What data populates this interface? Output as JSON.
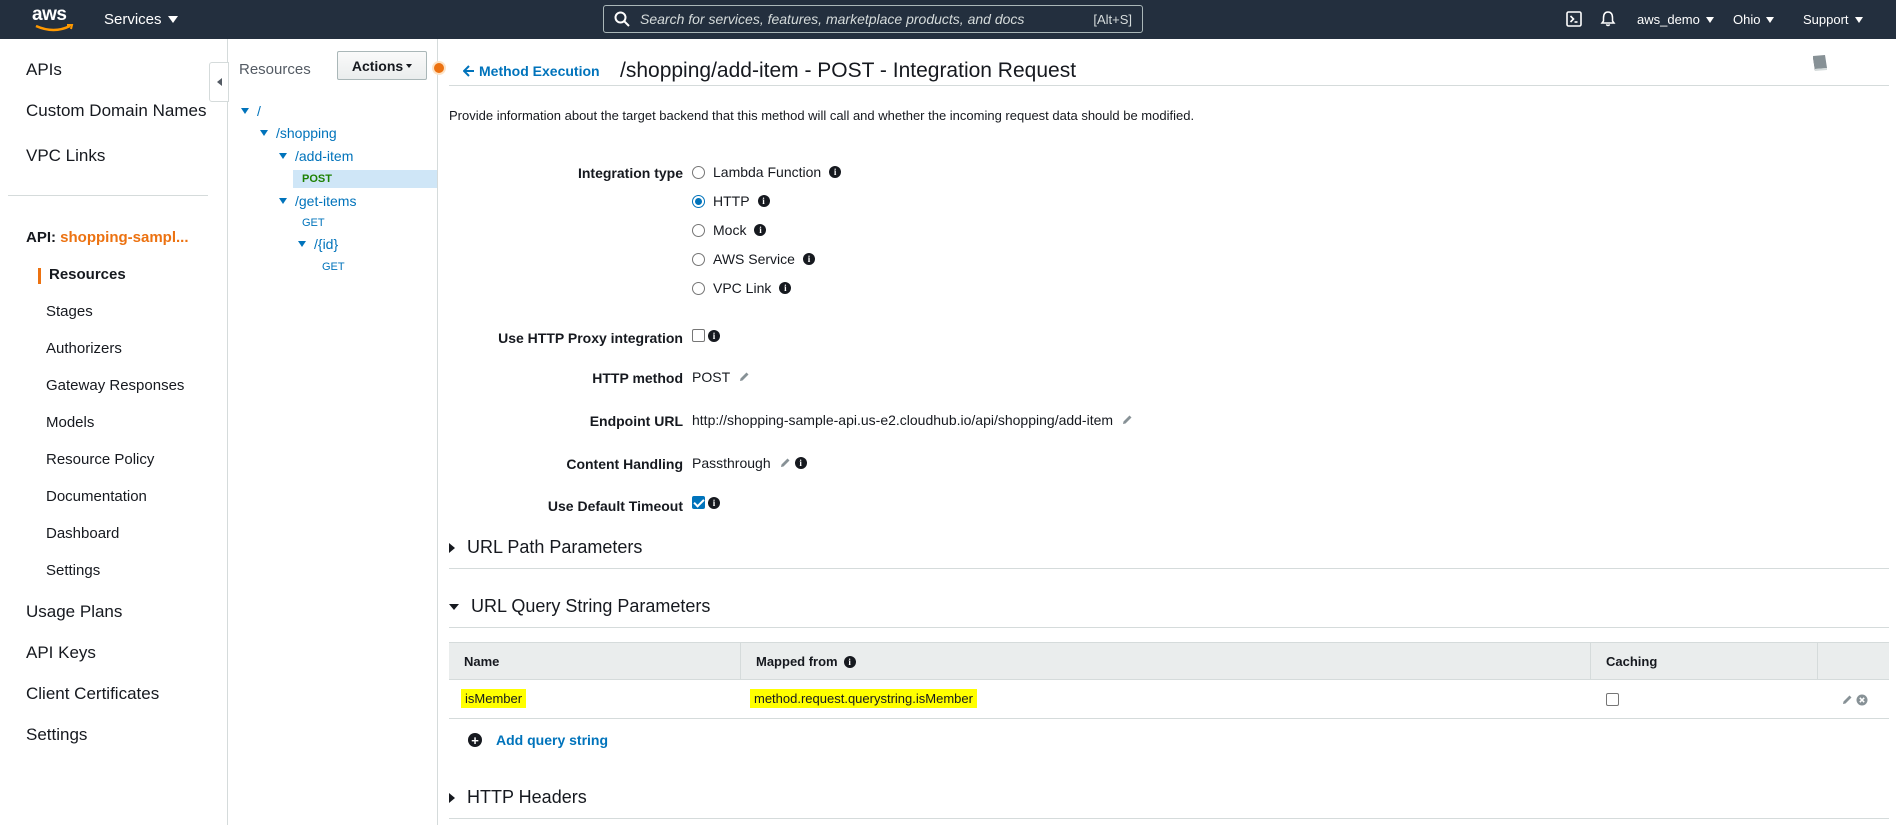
{
  "topnav": {
    "logo_text": "aws",
    "services_label": "Services",
    "search_placeholder": "Search for services, features, marketplace products, and docs",
    "search_shortcut": "[Alt+S]",
    "account_label": "aws_demo",
    "region_label": "Ohio",
    "support_label": "Support",
    "icons": [
      "cloudshell-icon",
      "bell-icon",
      "search-icon"
    ]
  },
  "sidebar": {
    "top_items": [
      {
        "label": "APIs"
      },
      {
        "label": "Custom Domain Names"
      },
      {
        "label": "VPC Links"
      }
    ],
    "api_prefix": "API:",
    "api_name": "shopping-sampl...",
    "api_items": [
      {
        "label": "Resources",
        "active": true
      },
      {
        "label": "Stages"
      },
      {
        "label": "Authorizers"
      },
      {
        "label": "Gateway Responses"
      },
      {
        "label": "Models"
      },
      {
        "label": "Resource Policy"
      },
      {
        "label": "Documentation"
      },
      {
        "label": "Dashboard"
      },
      {
        "label": "Settings"
      }
    ],
    "bottom_items": [
      {
        "label": "Usage Plans"
      },
      {
        "label": "API Keys"
      },
      {
        "label": "Client Certificates"
      },
      {
        "label": "Settings"
      }
    ]
  },
  "tree": {
    "title": "Resources",
    "actions_label": "Actions",
    "nodes": [
      {
        "label": "/"
      },
      {
        "label": "/shopping"
      },
      {
        "label": "/add-item"
      },
      {
        "label": "POST",
        "selected": true
      },
      {
        "label": "/get-items"
      },
      {
        "label": "GET"
      },
      {
        "label": "/{id}"
      },
      {
        "label": "GET"
      }
    ]
  },
  "main": {
    "back_label": "Method Execution",
    "title": "/shopping/add-item - POST - Integration Request",
    "description": "Provide information about the target backend that this method will call and whether the incoming request data should be modified.",
    "integration_type": {
      "label": "Integration type",
      "options": [
        {
          "label": "Lambda Function",
          "selected": false
        },
        {
          "label": "HTTP",
          "selected": true
        },
        {
          "label": "Mock",
          "selected": false
        },
        {
          "label": "AWS Service",
          "selected": false
        },
        {
          "label": "VPC Link",
          "selected": false
        }
      ]
    },
    "proxy": {
      "label": "Use HTTP Proxy integration",
      "checked": false
    },
    "http_method": {
      "label": "HTTP method",
      "value": "POST"
    },
    "endpoint_url": {
      "label": "Endpoint URL",
      "value": "http://shopping-sample-api.us-e2.cloudhub.io/api/shopping/add-item"
    },
    "content_handling": {
      "label": "Content Handling",
      "value": "Passthrough"
    },
    "default_timeout": {
      "label": "Use Default Timeout",
      "checked": true
    },
    "sections": {
      "url_path": "URL Path Parameters",
      "url_query": "URL Query String Parameters",
      "http_headers": "HTTP Headers"
    },
    "query_table": {
      "headers": [
        "Name",
        "Mapped from",
        "Caching"
      ],
      "rows": [
        {
          "name": "isMember",
          "mapped_from": "method.request.querystring.isMember",
          "caching": false
        }
      ],
      "add_label": "Add query string"
    }
  },
  "colors": {
    "nav_bg": "#232f3e",
    "link": "#0073bb",
    "accent": "#ec7211",
    "highlight": "#ffff00"
  }
}
